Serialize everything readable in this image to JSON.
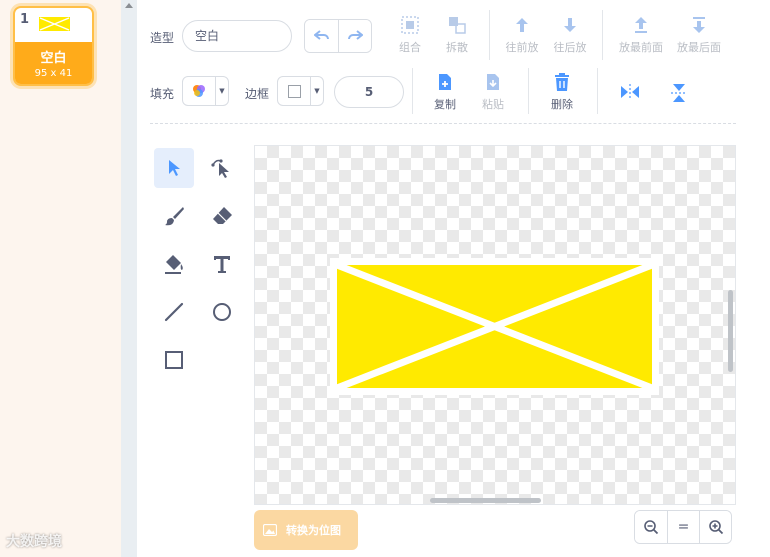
{
  "costume_list": {
    "items": [
      {
        "index": "1",
        "name": "空白",
        "size": "95 x 41"
      }
    ]
  },
  "watermark": "大数跨境",
  "toolbar": {
    "costume_label": "造型",
    "costume_name": "空白",
    "undo_icon": "undo-icon",
    "redo_icon": "redo-icon",
    "group_label": "组合",
    "ungroup_label": "拆散",
    "forward_label": "往前放",
    "backward_label": "往后放",
    "front_label": "放最前面",
    "back_label": "放最后面",
    "fill_label": "填充",
    "outline_label": "边框",
    "outline_width": "5",
    "copy_label": "复制",
    "paste_label": "粘贴",
    "delete_label": "删除",
    "flip_h_icon": "flip-horizontal-icon",
    "flip_v_icon": "flip-vertical-icon"
  },
  "tools": [
    "select",
    "reshape",
    "brush",
    "eraser",
    "fill",
    "text",
    "line",
    "circle",
    "rectangle"
  ],
  "selected_tool": "select",
  "canvas": {
    "art": "yellow-rectangle-with-white-x",
    "fill_color": "#ffea00",
    "stroke_color": "#ffffff"
  },
  "bottom": {
    "convert_bitmap_label": "转换为位图",
    "zoom_out_icon": "zoom-out-icon",
    "zoom_reset_label": "=",
    "zoom_in_icon": "zoom-in-icon"
  },
  "colors": {
    "accent_orange": "#ffab1a",
    "accent_blue": "#4c97ff",
    "text_gray": "#575e75",
    "disabled_gray": "#b9bdc4"
  }
}
